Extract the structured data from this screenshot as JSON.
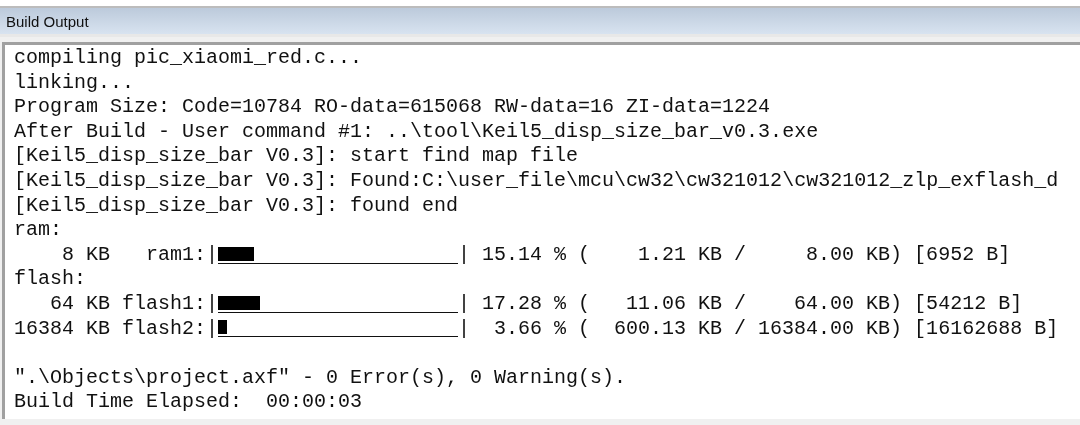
{
  "panel": {
    "title": "Build Output"
  },
  "lines": [
    {
      "kind": "text",
      "text": "compiling pic_xiaomi_red.c..."
    },
    {
      "kind": "text",
      "text": "linking..."
    },
    {
      "kind": "text",
      "text": "Program Size: Code=10784 RO-data=615068 RW-data=16 ZI-data=1224"
    },
    {
      "kind": "text",
      "text": "After Build - User command #1: ..\\tool\\Keil5_disp_size_bar_v0.3.exe"
    },
    {
      "kind": "text",
      "text": "[Keil5_disp_size_bar V0.3]: start find map file"
    },
    {
      "kind": "text",
      "text": "[Keil5_disp_size_bar V0.3]: Found:C:\\user_file\\mcu\\cw32\\cw321012\\cw321012_zlp_exflash_d"
    },
    {
      "kind": "text",
      "text": "[Keil5_disp_size_bar V0.3]: found end"
    },
    {
      "kind": "text",
      "text": "ram:"
    },
    {
      "kind": "bar",
      "prefix": "    8 KB   ram1:|",
      "level": 0.1514,
      "suffix": "| 15.14 % (    1.21 KB /     8.00 KB) [6952 B]"
    },
    {
      "kind": "text",
      "text": "flash:"
    },
    {
      "kind": "bar",
      "prefix": "   64 KB flash1:|",
      "level": 0.1728,
      "suffix": "| 17.28 % (   11.06 KB /    64.00 KB) [54212 B]"
    },
    {
      "kind": "bar",
      "prefix": "16384 KB flash2:|",
      "level": 0.0366,
      "suffix": "|  3.66 % (  600.13 KB / 16384.00 KB) [16162688 B]"
    },
    {
      "kind": "blank"
    },
    {
      "kind": "text",
      "text": "\".\\Objects\\project.axf\" - 0 Error(s), 0 Warning(s)."
    },
    {
      "kind": "text",
      "text": "Build Time Elapsed:  00:00:03"
    }
  ]
}
